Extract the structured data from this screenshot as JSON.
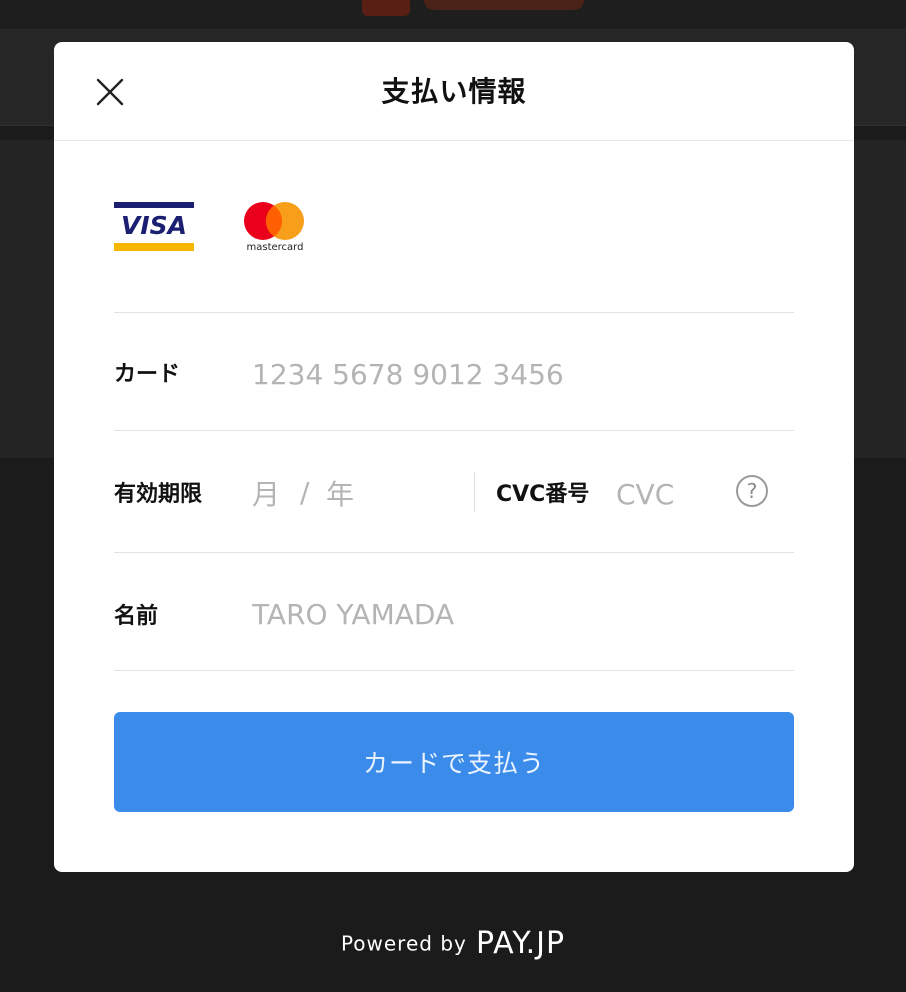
{
  "modal": {
    "title": "支払い情報",
    "close_icon": "close-icon"
  },
  "brands": {
    "visa": "VISA",
    "mastercard": "mastercard"
  },
  "form": {
    "card": {
      "label": "カード",
      "placeholder": "1234 5678 9012 3456",
      "value": ""
    },
    "expiry": {
      "label": "有効期限",
      "month_placeholder": "月",
      "separator": "/",
      "year_placeholder": "年"
    },
    "cvc": {
      "label": "CVC番号",
      "placeholder": "CVC",
      "help_icon": "question-icon",
      "help_glyph": "?"
    },
    "name": {
      "label": "名前",
      "placeholder": "TARO YAMADA",
      "value": ""
    }
  },
  "pay_button": {
    "label": "カードで支払う"
  },
  "footer": {
    "powered_by": "Powered by",
    "brand": "PAY.JP"
  },
  "colors": {
    "button": "#3b8beb",
    "overlay": "#1b1b1b",
    "visa_blue": "#1a1f71",
    "visa_gold": "#f7b600",
    "mc_red": "#eb001b",
    "mc_orange": "#f79e1b"
  }
}
